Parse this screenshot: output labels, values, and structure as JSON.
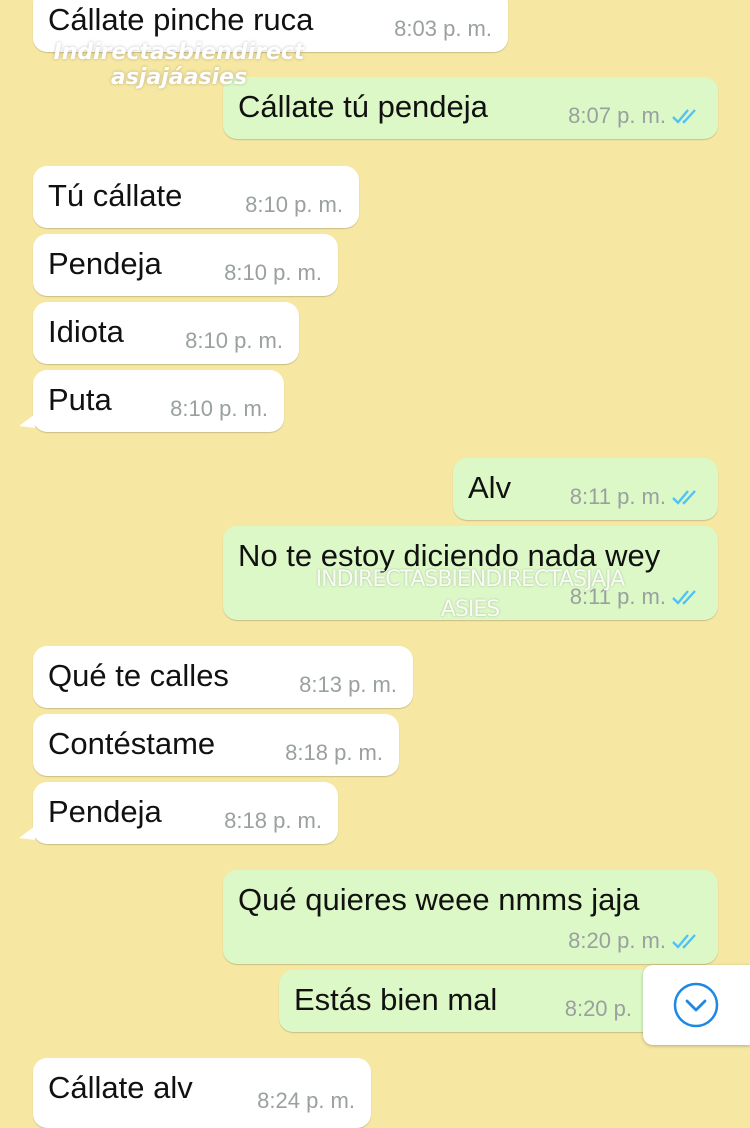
{
  "watermarks": {
    "top_lines": [
      "Indirectasbiendirect",
      "asjajáasies"
    ],
    "middle_lines": [
      "INDIRECTASBIENDIRECTASJAJA",
      "ASIES"
    ]
  },
  "messages": [
    {
      "dir": "in",
      "text": "Cállate pinche ruca",
      "time": "8:03 p. m."
    },
    {
      "dir": "out",
      "text": "Cállate tú pendeja",
      "time": "8:07 p. m.",
      "read": true
    },
    {
      "dir": "in",
      "text": "Tú cállate",
      "time": "8:10 p. m."
    },
    {
      "dir": "in",
      "text": "Pendeja",
      "time": "8:10 p. m."
    },
    {
      "dir": "in",
      "text": "Idiota",
      "time": "8:10 p. m."
    },
    {
      "dir": "in",
      "text": "Puta",
      "time": "8:10 p. m."
    },
    {
      "dir": "out",
      "text": "Alv",
      "time": "8:11 p. m.",
      "read": true
    },
    {
      "dir": "out",
      "text": "No te estoy diciendo nada wey",
      "time": "8:11 p. m.",
      "read": true
    },
    {
      "dir": "in",
      "text": "Qué te calles",
      "time": "8:13 p. m."
    },
    {
      "dir": "in",
      "text": "Contéstame",
      "time": "8:18 p. m."
    },
    {
      "dir": "in",
      "text": "Pendeja",
      "time": "8:18 p. m."
    },
    {
      "dir": "out",
      "text": "Qué quieres weee nmms jaja",
      "time": "8:20 p. m.",
      "read": true
    },
    {
      "dir": "out",
      "text": "Estás bien mal",
      "time": "8:20 p."
    },
    {
      "dir": "in",
      "text": "Cállate alv",
      "time": "8:24 p. m."
    }
  ],
  "scroll_button": {
    "icon": "chevron-down-icon"
  },
  "colors": {
    "background": "#f6e7a2",
    "incoming": "#ffffff",
    "outgoing": "#dcf8c6",
    "read_ticks": "#4fc3f7",
    "scroll_icon": "#1e88e5"
  }
}
